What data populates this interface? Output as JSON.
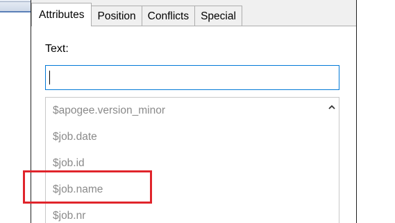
{
  "tabs": [
    {
      "label": "Attributes",
      "active": true
    },
    {
      "label": "Position",
      "active": false
    },
    {
      "label": "Conflicts",
      "active": false
    },
    {
      "label": "Special",
      "active": false
    }
  ],
  "text_field": {
    "label": "Text:",
    "value": ""
  },
  "suggestions": [
    "$apogee.version_minor",
    "$job.date",
    "$job.id",
    "$job.name",
    "$job.nr"
  ],
  "highlighted_item": "$job.name",
  "icons": {
    "scroll_up": "chevron-up-icon"
  },
  "colors": {
    "highlight": "#e0242b",
    "input_focus": "#0078d7",
    "suggestion_text": "#8a8a8a"
  }
}
